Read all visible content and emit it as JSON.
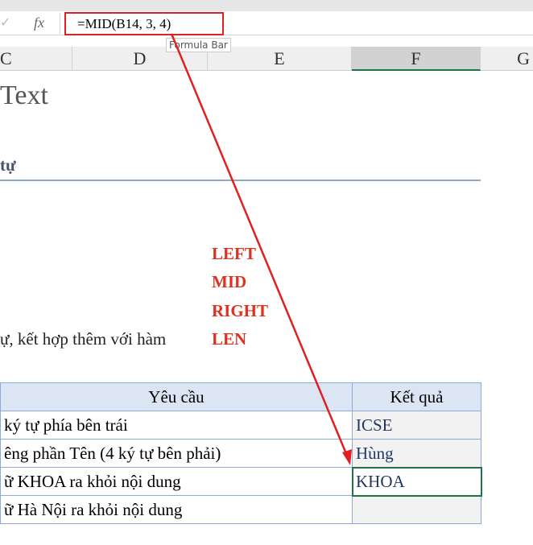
{
  "formula_bar": {
    "check_icon": "✓",
    "fx": "fx",
    "formula": "=MID(B14,  3,  4)",
    "tooltip": "Formula Bar"
  },
  "columns": [
    "C",
    "D",
    "E",
    "F",
    "G"
  ],
  "sheet": {
    "title": "Text",
    "subtitle": "tự",
    "functions": [
      "LEFT",
      "MID",
      "RIGHT",
      "LEN"
    ],
    "description": "ự, kết hợp thêm với hàm",
    "table": {
      "headers": [
        "Yêu cầu",
        "Kết quả"
      ],
      "rows": [
        {
          "req": "ký tự phía bên trái",
          "res": "ICSE"
        },
        {
          "req": "êng phần Tên (4 ký tự bên phải)",
          "res": "Hùng"
        },
        {
          "req": "ữ KHOA ra khỏi nội dung",
          "res": "KHOA"
        },
        {
          "req": "ữ Hà Nội ra khỏi nội dung",
          "res": ""
        }
      ]
    }
  },
  "colors": {
    "annotation": "#e02020",
    "selected": "#217346"
  }
}
